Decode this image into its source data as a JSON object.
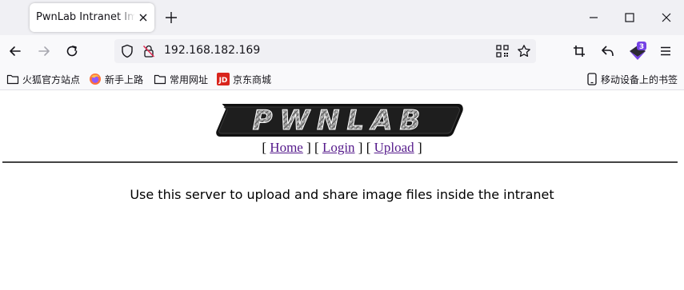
{
  "browser": {
    "tab": {
      "title": "PwnLab Intranet Image Hosting"
    },
    "address": {
      "url": "192.168.182.169"
    },
    "badge_count": "3",
    "bookmarks": [
      {
        "label": "火狐官方站点",
        "icon": "folder-icon"
      },
      {
        "label": "新手上路",
        "icon": "firefox-icon"
      },
      {
        "label": "常用网址",
        "icon": "folder-icon"
      },
      {
        "label": "京东商城",
        "icon": "jd-icon"
      }
    ],
    "mobile_bookmarks": "移动设备上的书签",
    "colors": {
      "chrome_bg": "#f0f0f4",
      "toolbar_bg": "#f9f9fb",
      "badge": "#7542e5",
      "link": "#551a8b"
    }
  },
  "page": {
    "logo_text": "PWNLAB",
    "nav": {
      "bracket_open": "[",
      "bracket_close": "]",
      "home": "Home",
      "login": "Login",
      "upload": "Upload"
    },
    "message": "Use this server to upload and share image files inside the intranet"
  }
}
